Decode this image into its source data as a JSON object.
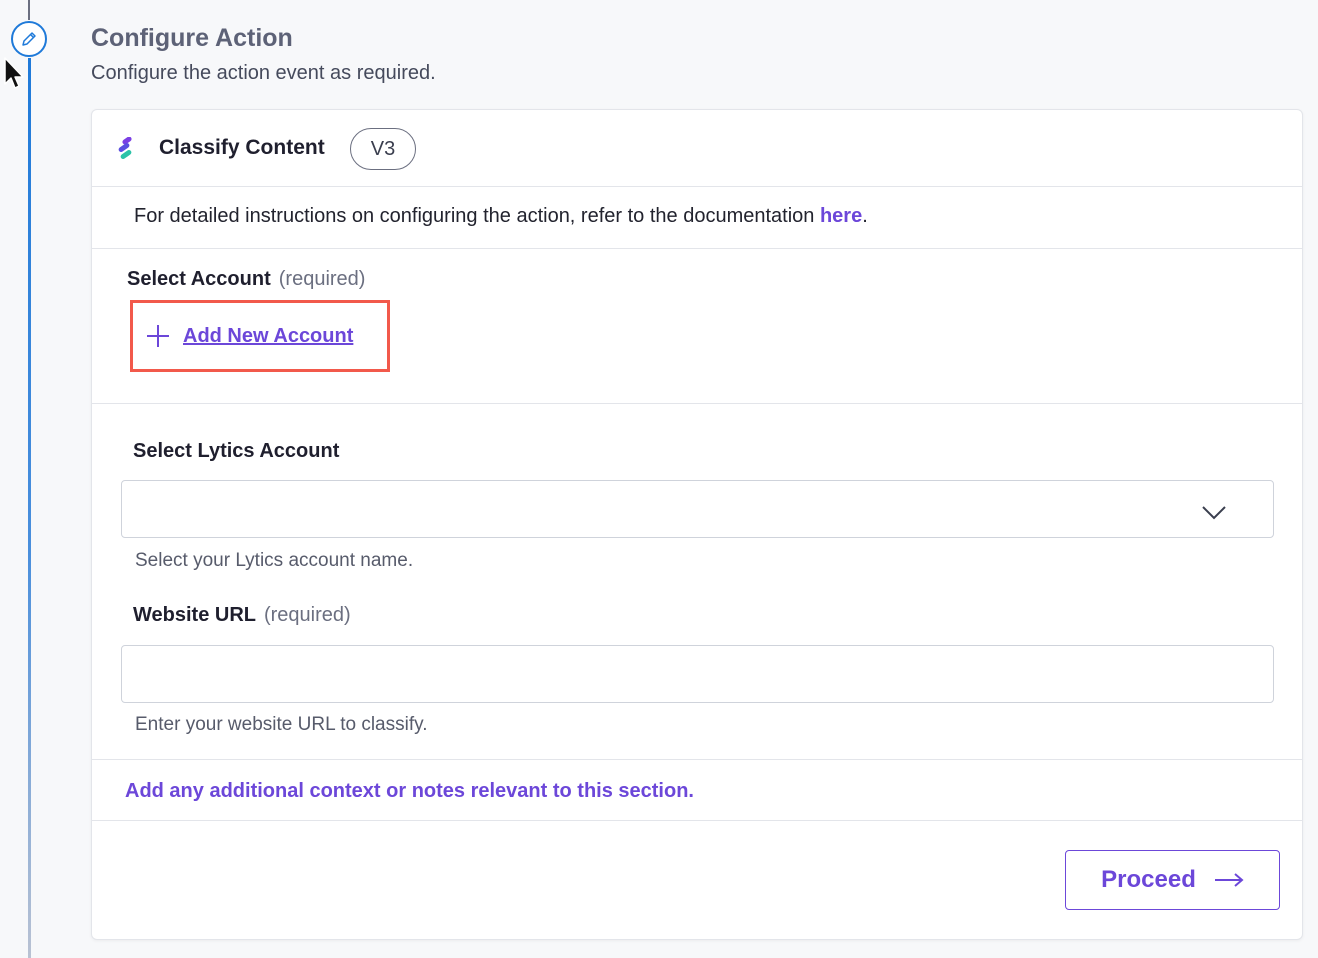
{
  "header": {
    "title": "Configure Action",
    "subtitle": "Configure the action event as required."
  },
  "card": {
    "app_title": "Classify Content",
    "version": "V3",
    "doc_text": "For detailed instructions on configuring the action, refer to the documentation ",
    "doc_link": "here",
    "doc_end": "."
  },
  "select_account": {
    "label": "Select Account",
    "required": "(required)",
    "add_new": "Add New Account"
  },
  "lytics_account": {
    "label": "Select Lytics Account",
    "value": "",
    "helper": "Select your Lytics account name."
  },
  "website_url": {
    "label": "Website URL",
    "required": "(required)",
    "value": "",
    "helper": "Enter your website URL to classify."
  },
  "context_note": "Add any additional context or notes relevant to this section.",
  "proceed": {
    "label": "Proceed"
  },
  "icons": {
    "step": "pencil-icon",
    "logo": "contentstack-logo-icon",
    "add": "plus-icon",
    "dropdown": "chevron-down-icon",
    "proceed": "arrow-right-icon",
    "cursor": "mouse-cursor-icon"
  },
  "colors": {
    "accent": "#6c47d9",
    "highlight_border": "#f2594b",
    "timeline": "#1f7ad9"
  }
}
